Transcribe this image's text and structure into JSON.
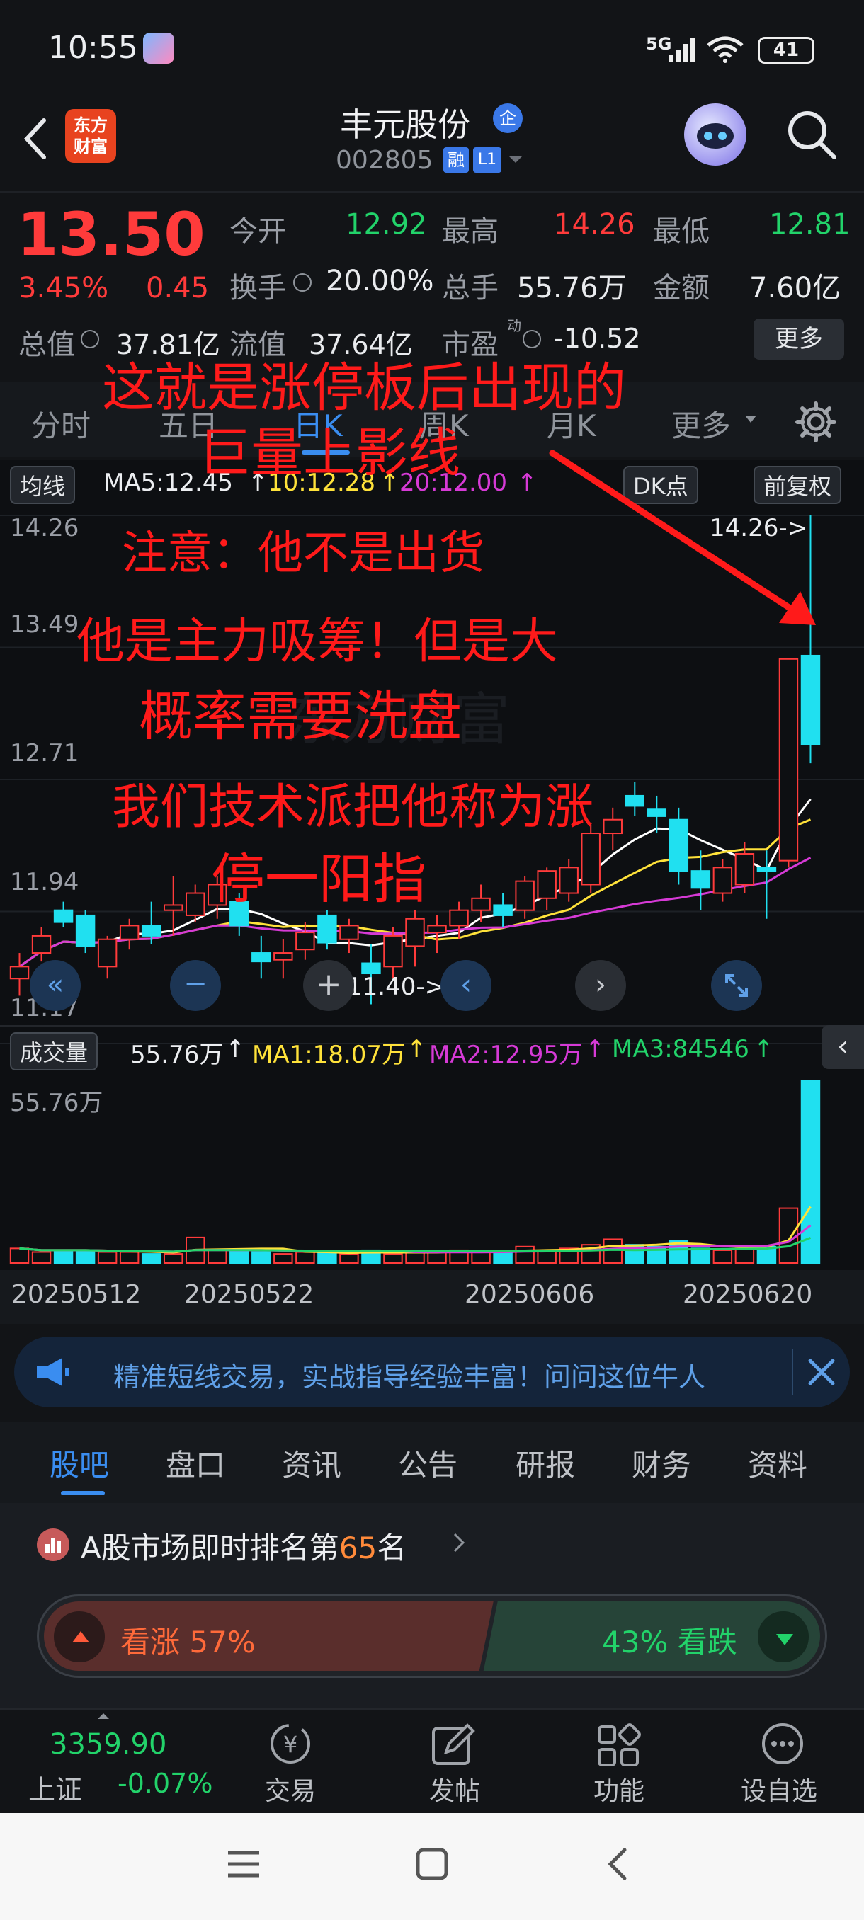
{
  "status": {
    "time": "10:55",
    "network": "5G",
    "battery": "41"
  },
  "header": {
    "title": "丰元股份",
    "title_badge": "企",
    "code": "002805",
    "tag_rong": "融",
    "tag_l1": "L1",
    "logo_top": "东方",
    "logo_bottom": "财富"
  },
  "quote": {
    "price": "13.50",
    "change_pct": "3.45%",
    "change_abs": "0.45",
    "open_label": "今开",
    "open": "12.92",
    "high_label": "最高",
    "high": "14.26",
    "low_label": "最低",
    "low": "12.81",
    "turnover_label": "换手",
    "turnover": "20.00%",
    "volume_label": "总手",
    "volume": "55.76万",
    "amount_label": "金额",
    "amount": "7.60亿",
    "mktcap_label": "总值",
    "mktcap": "37.81亿",
    "float_label": "流值",
    "float": "37.64亿",
    "pe_label": "市盈",
    "pe_sup": "动",
    "pe": "-10.52",
    "more": "更多"
  },
  "periods": {
    "tabs": [
      "分时",
      "五日",
      "日K",
      "周K",
      "月K",
      "更多"
    ],
    "active": "日K"
  },
  "kline": {
    "ma_selector": "均线",
    "ma5": "MA5:12.45",
    "ma10": "10:12.28",
    "ma20": "20:12.00",
    "dk": "DK点",
    "adjust": "前复权",
    "axis_labels": [
      "14.26",
      "13.49",
      "12.71",
      "11.94",
      "11.17"
    ],
    "high_marker": "14.26->",
    "low_marker": "11.40->",
    "watermark": "东方财富"
  },
  "volume": {
    "selector": "成交量",
    "vol": "55.76万",
    "ma1": "MA1:18.07万",
    "ma2": "MA2:12.95万",
    "ma3": "MA3:84546",
    "axis_max": "55.76万",
    "dates": [
      "20250512",
      "20250522",
      "20250606",
      "20250620"
    ]
  },
  "annotations": {
    "line1": "这就是涨停板后出现的",
    "line2": "巨量上影线",
    "line3": "注意：他不是出货",
    "line4": "他是主力吸筹！但是大",
    "line5": "概率需要洗盘",
    "line6": "我们技术派把他称为涨",
    "line7": "停一阳指"
  },
  "banner": {
    "text": "精准短线交易，实战指导经验丰富！问问这位牛人"
  },
  "content_tabs": {
    "tabs": [
      "股吧",
      "盘口",
      "资讯",
      "公告",
      "研报",
      "财务",
      "资料"
    ],
    "active": "股吧"
  },
  "rank": {
    "prefix": "A股市场即时排名第",
    "rank": "65",
    "suffix": "名"
  },
  "vote": {
    "up_label": "看涨 57%",
    "down_label": "43% 看跌",
    "up_pct": 57,
    "down_pct": 43
  },
  "bottomnav": {
    "index_value": "3359.90",
    "index_name": "上证",
    "index_change": "-0.07%",
    "items": [
      "交易",
      "发帖",
      "功能",
      "设自选"
    ]
  },
  "colors": {
    "up": "#ff3b3b",
    "down": "#22d36a",
    "accent": "#3a8df0",
    "ma5": "#ffffff",
    "ma10": "#ffe23a",
    "ma20": "#d63ad6"
  },
  "chart_data": {
    "type": "candlestick",
    "ylim": [
      11.17,
      14.26
    ],
    "candles": [
      {
        "o": 11.55,
        "h": 11.7,
        "l": 11.45,
        "c": 11.62,
        "v": 8
      },
      {
        "o": 11.7,
        "h": 11.85,
        "l": 11.65,
        "c": 11.8,
        "v": 6
      },
      {
        "o": 11.95,
        "h": 12.0,
        "l": 11.85,
        "c": 11.88,
        "v": 7
      },
      {
        "o": 11.92,
        "h": 11.95,
        "l": 11.7,
        "c": 11.74,
        "v": 7
      },
      {
        "o": 11.62,
        "h": 11.8,
        "l": 11.55,
        "c": 11.78,
        "v": 6
      },
      {
        "o": 11.78,
        "h": 11.9,
        "l": 11.72,
        "c": 11.86,
        "v": 6
      },
      {
        "o": 11.86,
        "h": 12.0,
        "l": 11.75,
        "c": 11.8,
        "v": 5
      },
      {
        "o": 11.95,
        "h": 12.15,
        "l": 11.8,
        "c": 11.98,
        "v": 5
      },
      {
        "o": 11.92,
        "h": 12.1,
        "l": 11.88,
        "c": 12.05,
        "v": 14
      },
      {
        "o": 11.98,
        "h": 12.15,
        "l": 11.9,
        "c": 12.1,
        "v": 7
      },
      {
        "o": 12.0,
        "h": 12.05,
        "l": 11.8,
        "c": 11.86,
        "v": 7
      },
      {
        "o": 11.7,
        "h": 11.8,
        "l": 11.55,
        "c": 11.65,
        "v": 6
      },
      {
        "o": 11.66,
        "h": 11.78,
        "l": 11.55,
        "c": 11.7,
        "v": 5
      },
      {
        "o": 11.72,
        "h": 11.88,
        "l": 11.66,
        "c": 11.82,
        "v": 6
      },
      {
        "o": 11.92,
        "h": 11.95,
        "l": 11.72,
        "c": 11.76,
        "v": 6
      },
      {
        "o": 11.78,
        "h": 11.9,
        "l": 11.7,
        "c": 11.86,
        "v": 5
      },
      {
        "o": 11.64,
        "h": 11.75,
        "l": 11.4,
        "c": 11.58,
        "v": 7
      },
      {
        "o": 11.62,
        "h": 11.85,
        "l": 11.55,
        "c": 11.8,
        "v": 5
      },
      {
        "o": 11.74,
        "h": 11.95,
        "l": 11.62,
        "c": 11.9,
        "v": 6
      },
      {
        "o": 11.82,
        "h": 11.92,
        "l": 11.7,
        "c": 11.86,
        "v": 6
      },
      {
        "o": 11.86,
        "h": 12.0,
        "l": 11.78,
        "c": 11.95,
        "v": 7
      },
      {
        "o": 11.95,
        "h": 12.1,
        "l": 11.88,
        "c": 12.02,
        "v": 6
      },
      {
        "o": 11.98,
        "h": 12.05,
        "l": 11.85,
        "c": 11.92,
        "v": 6
      },
      {
        "o": 11.95,
        "h": 12.15,
        "l": 11.9,
        "c": 12.12,
        "v": 9
      },
      {
        "o": 12.02,
        "h": 12.2,
        "l": 11.95,
        "c": 12.18,
        "v": 7
      },
      {
        "o": 12.05,
        "h": 12.25,
        "l": 12.0,
        "c": 12.2,
        "v": 8
      },
      {
        "o": 12.1,
        "h": 12.45,
        "l": 12.05,
        "c": 12.4,
        "v": 10
      },
      {
        "o": 12.4,
        "h": 12.55,
        "l": 12.3,
        "c": 12.48,
        "v": 13
      },
      {
        "o": 12.62,
        "h": 12.7,
        "l": 12.5,
        "c": 12.56,
        "v": 10
      },
      {
        "o": 12.54,
        "h": 12.62,
        "l": 12.4,
        "c": 12.5,
        "v": 9
      },
      {
        "o": 12.48,
        "h": 12.55,
        "l": 12.1,
        "c": 12.18,
        "v": 12
      },
      {
        "o": 12.18,
        "h": 12.3,
        "l": 11.95,
        "c": 12.08,
        "v": 8
      },
      {
        "o": 12.05,
        "h": 12.25,
        "l": 12.0,
        "c": 12.2,
        "v": 7
      },
      {
        "o": 12.1,
        "h": 12.35,
        "l": 12.05,
        "c": 12.28,
        "v": 8
      },
      {
        "o": 12.2,
        "h": 12.3,
        "l": 11.9,
        "c": 12.18,
        "v": 9
      },
      {
        "o": 12.24,
        "h": 13.42,
        "l": 12.2,
        "c": 13.42,
        "v": 30
      },
      {
        "o": 13.44,
        "h": 14.26,
        "l": 12.81,
        "c": 12.92,
        "v": 100
      }
    ]
  }
}
